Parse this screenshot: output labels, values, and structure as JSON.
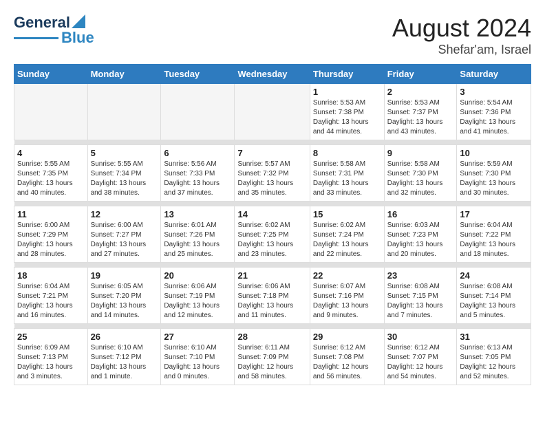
{
  "header": {
    "logo_general": "General",
    "logo_blue": "Blue",
    "main_title": "August 2024",
    "subtitle": "Shefar'am, Israel"
  },
  "days_of_week": [
    "Sunday",
    "Monday",
    "Tuesday",
    "Wednesday",
    "Thursday",
    "Friday",
    "Saturday"
  ],
  "weeks": [
    [
      {
        "day": "",
        "info": ""
      },
      {
        "day": "",
        "info": ""
      },
      {
        "day": "",
        "info": ""
      },
      {
        "day": "",
        "info": ""
      },
      {
        "day": "1",
        "info": "Sunrise: 5:53 AM\nSunset: 7:38 PM\nDaylight: 13 hours\nand 44 minutes."
      },
      {
        "day": "2",
        "info": "Sunrise: 5:53 AM\nSunset: 7:37 PM\nDaylight: 13 hours\nand 43 minutes."
      },
      {
        "day": "3",
        "info": "Sunrise: 5:54 AM\nSunset: 7:36 PM\nDaylight: 13 hours\nand 41 minutes."
      }
    ],
    [
      {
        "day": "4",
        "info": "Sunrise: 5:55 AM\nSunset: 7:35 PM\nDaylight: 13 hours\nand 40 minutes."
      },
      {
        "day": "5",
        "info": "Sunrise: 5:55 AM\nSunset: 7:34 PM\nDaylight: 13 hours\nand 38 minutes."
      },
      {
        "day": "6",
        "info": "Sunrise: 5:56 AM\nSunset: 7:33 PM\nDaylight: 13 hours\nand 37 minutes."
      },
      {
        "day": "7",
        "info": "Sunrise: 5:57 AM\nSunset: 7:32 PM\nDaylight: 13 hours\nand 35 minutes."
      },
      {
        "day": "8",
        "info": "Sunrise: 5:58 AM\nSunset: 7:31 PM\nDaylight: 13 hours\nand 33 minutes."
      },
      {
        "day": "9",
        "info": "Sunrise: 5:58 AM\nSunset: 7:30 PM\nDaylight: 13 hours\nand 32 minutes."
      },
      {
        "day": "10",
        "info": "Sunrise: 5:59 AM\nSunset: 7:30 PM\nDaylight: 13 hours\nand 30 minutes."
      }
    ],
    [
      {
        "day": "11",
        "info": "Sunrise: 6:00 AM\nSunset: 7:29 PM\nDaylight: 13 hours\nand 28 minutes."
      },
      {
        "day": "12",
        "info": "Sunrise: 6:00 AM\nSunset: 7:27 PM\nDaylight: 13 hours\nand 27 minutes."
      },
      {
        "day": "13",
        "info": "Sunrise: 6:01 AM\nSunset: 7:26 PM\nDaylight: 13 hours\nand 25 minutes."
      },
      {
        "day": "14",
        "info": "Sunrise: 6:02 AM\nSunset: 7:25 PM\nDaylight: 13 hours\nand 23 minutes."
      },
      {
        "day": "15",
        "info": "Sunrise: 6:02 AM\nSunset: 7:24 PM\nDaylight: 13 hours\nand 22 minutes."
      },
      {
        "day": "16",
        "info": "Sunrise: 6:03 AM\nSunset: 7:23 PM\nDaylight: 13 hours\nand 20 minutes."
      },
      {
        "day": "17",
        "info": "Sunrise: 6:04 AM\nSunset: 7:22 PM\nDaylight: 13 hours\nand 18 minutes."
      }
    ],
    [
      {
        "day": "18",
        "info": "Sunrise: 6:04 AM\nSunset: 7:21 PM\nDaylight: 13 hours\nand 16 minutes."
      },
      {
        "day": "19",
        "info": "Sunrise: 6:05 AM\nSunset: 7:20 PM\nDaylight: 13 hours\nand 14 minutes."
      },
      {
        "day": "20",
        "info": "Sunrise: 6:06 AM\nSunset: 7:19 PM\nDaylight: 13 hours\nand 12 minutes."
      },
      {
        "day": "21",
        "info": "Sunrise: 6:06 AM\nSunset: 7:18 PM\nDaylight: 13 hours\nand 11 minutes."
      },
      {
        "day": "22",
        "info": "Sunrise: 6:07 AM\nSunset: 7:16 PM\nDaylight: 13 hours\nand 9 minutes."
      },
      {
        "day": "23",
        "info": "Sunrise: 6:08 AM\nSunset: 7:15 PM\nDaylight: 13 hours\nand 7 minutes."
      },
      {
        "day": "24",
        "info": "Sunrise: 6:08 AM\nSunset: 7:14 PM\nDaylight: 13 hours\nand 5 minutes."
      }
    ],
    [
      {
        "day": "25",
        "info": "Sunrise: 6:09 AM\nSunset: 7:13 PM\nDaylight: 13 hours\nand 3 minutes."
      },
      {
        "day": "26",
        "info": "Sunrise: 6:10 AM\nSunset: 7:12 PM\nDaylight: 13 hours\nand 1 minute."
      },
      {
        "day": "27",
        "info": "Sunrise: 6:10 AM\nSunset: 7:10 PM\nDaylight: 13 hours\nand 0 minutes."
      },
      {
        "day": "28",
        "info": "Sunrise: 6:11 AM\nSunset: 7:09 PM\nDaylight: 12 hours\nand 58 minutes."
      },
      {
        "day": "29",
        "info": "Sunrise: 6:12 AM\nSunset: 7:08 PM\nDaylight: 12 hours\nand 56 minutes."
      },
      {
        "day": "30",
        "info": "Sunrise: 6:12 AM\nSunset: 7:07 PM\nDaylight: 12 hours\nand 54 minutes."
      },
      {
        "day": "31",
        "info": "Sunrise: 6:13 AM\nSunset: 7:05 PM\nDaylight: 12 hours\nand 52 minutes."
      }
    ]
  ]
}
